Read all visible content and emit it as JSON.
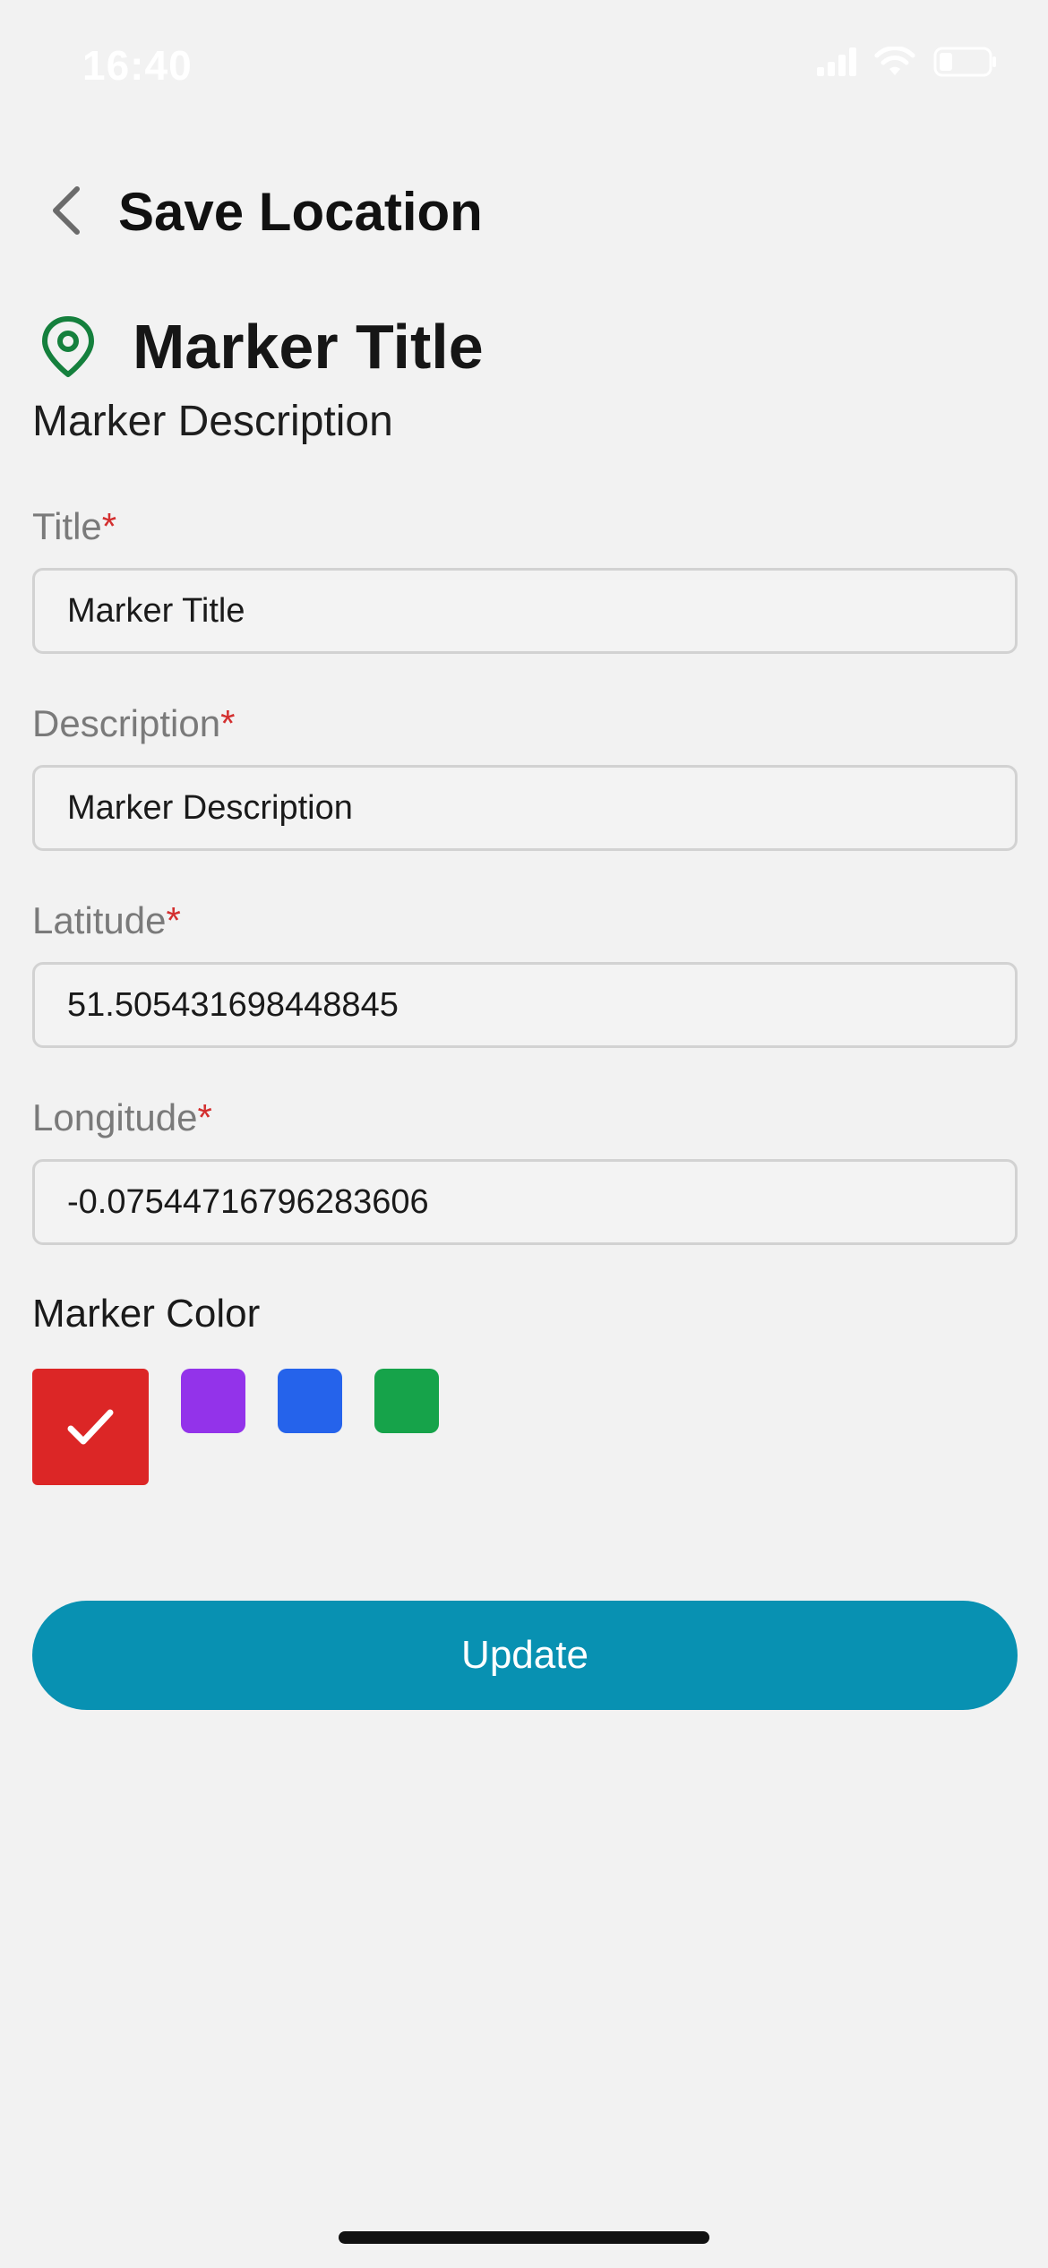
{
  "status_bar": {
    "time": "16:40",
    "icons": [
      "cellular-signal-icon",
      "wifi-icon",
      "battery-icon"
    ]
  },
  "header": {
    "back_icon": "chevron-left-icon",
    "title": "Save Location"
  },
  "summary": {
    "icon": "map-pin-icon",
    "title": "Marker Title",
    "description": "Marker Description"
  },
  "form": {
    "required_mark": "*",
    "fields": [
      {
        "label": "Title",
        "value": "Marker Title"
      },
      {
        "label": "Description",
        "value": "Marker Description"
      },
      {
        "label": "Latitude",
        "value": "51.505431698448845"
      },
      {
        "label": "Longitude",
        "value": "-0.07544716796283606"
      }
    ]
  },
  "marker_color": {
    "label": "Marker Color",
    "selected": "red",
    "options": [
      {
        "name": "red",
        "hex": "#dc2626"
      },
      {
        "name": "purple",
        "hex": "#9333ea"
      },
      {
        "name": "blue",
        "hex": "#2563eb"
      },
      {
        "name": "green",
        "hex": "#16a34a"
      }
    ]
  },
  "actions": {
    "update_label": "Update"
  },
  "colors": {
    "background": "#f2f2f2",
    "accent": "#0891b2",
    "required": "#d32f2f",
    "pin": "#15803d"
  }
}
